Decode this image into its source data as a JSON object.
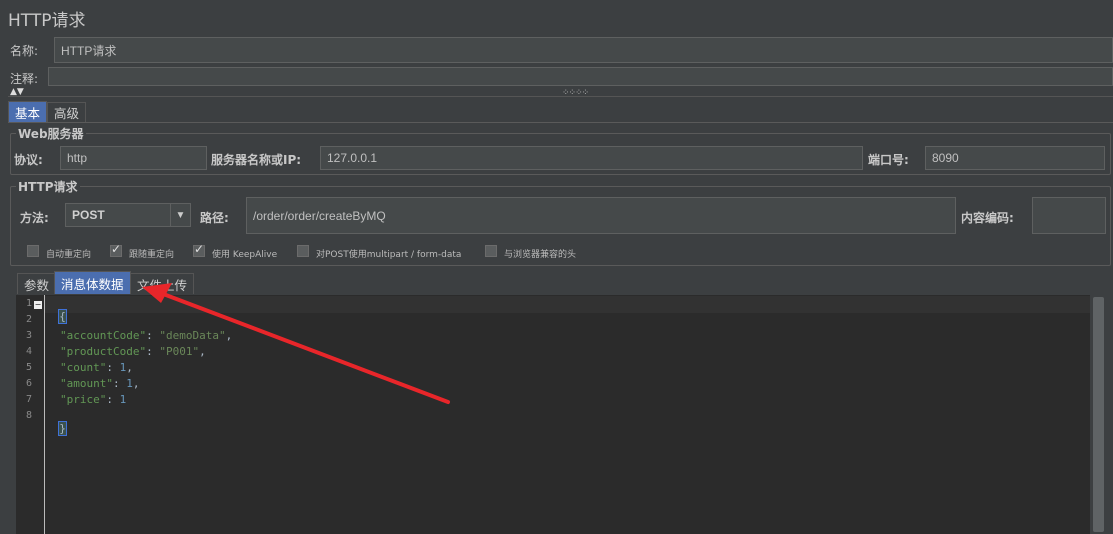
{
  "window": {
    "title": "HTTP请求"
  },
  "form": {
    "name_label": "名称:",
    "name_value": "HTTP请求",
    "comment_label": "注释:",
    "comment_value": ""
  },
  "tabs": {
    "basic": "基本",
    "advanced": "高级"
  },
  "web_server": {
    "group_title": "Web服务器",
    "protocol_label": "协议:",
    "protocol_value": "http",
    "server_label": "服务器名称或IP:",
    "server_value": "127.0.0.1",
    "port_label": "端口号:",
    "port_value": "8090"
  },
  "http_request": {
    "group_title": "HTTP请求",
    "method_label": "方法:",
    "method_value": "POST",
    "path_label": "路径:",
    "path_value": "/order/order/createByMQ",
    "encoding_label": "内容编码:",
    "encoding_value": ""
  },
  "options": [
    {
      "label": "自动重定向",
      "checked": false
    },
    {
      "label": "跟随重定向",
      "checked": true
    },
    {
      "label": "使用 KeepAlive",
      "checked": true
    },
    {
      "label": "对POST使用multipart / form-data",
      "checked": false
    },
    {
      "label": "与浏览器兼容的头",
      "checked": false
    }
  ],
  "body_tabs": {
    "params": "参数",
    "body_data": "消息体数据",
    "file_upload": "文件上传"
  },
  "editor": {
    "line_numbers": [
      "1",
      "2",
      "3",
      "4",
      "5",
      "6",
      "7",
      "8"
    ],
    "lines": [
      {
        "key": "\"accountCode\"",
        "value": "\"demoData\"",
        "value_type": "string",
        "trail": ","
      },
      {
        "key": "\"productCode\"",
        "value": "\"P001\"",
        "value_type": "string",
        "trail": ","
      },
      {
        "key": "\"count\"",
        "value": "1",
        "value_type": "number",
        "trail": ","
      },
      {
        "key": "\"amount\"",
        "value": "1",
        "value_type": "number",
        "trail": ","
      },
      {
        "key": "\"price\"",
        "value": "1",
        "value_type": "number",
        "trail": ""
      }
    ],
    "open_brace": "{",
    "close_brace": "}"
  },
  "colors": {
    "annotation_arrow": "#e8262a",
    "tab_active": "#4b6eaf"
  }
}
